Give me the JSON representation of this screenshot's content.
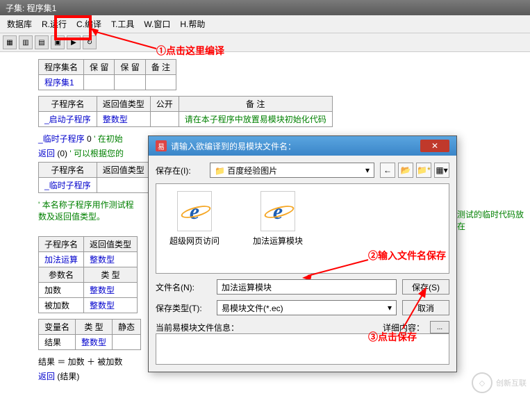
{
  "titlebar": "子集: 程序集1",
  "menu": {
    "db": "数据库",
    "run": "R.运行",
    "compile": "C.编译",
    "tools": "T.工具",
    "window": "W.窗口",
    "help": "H.帮助"
  },
  "annotations": {
    "a1": "①点击这里编译",
    "a2": "②输入文件名保存",
    "a3": "③点击保存",
    "side_note": "测试的临时代码放在"
  },
  "tables": {
    "t1": {
      "h1": "程序集名",
      "h2": "保  留",
      "h3": "保  留",
      "h4": "备  注",
      "r1c1": "程序集1"
    },
    "t2": {
      "h1": "子程序名",
      "h2": "返回值类型",
      "h3": "公开",
      "h4": "备  注",
      "r1c1": "_启动子程序",
      "r1c2": "整数型",
      "r1c4": "请在本子程序中放置易模块初始化代码"
    },
    "t3": {
      "h1": "子程序名",
      "h2": "返回值类型",
      "r1c1": "_临时子程序"
    },
    "t4": {
      "h1": "子程序名",
      "h2": "返回值类型",
      "r1c1": "加法运算",
      "r1c2": "整数型",
      "ph1": "参数名",
      "ph2": "类  型",
      "p1c1": "加数",
      "p1c2": "整数型",
      "p2c1": "被加数",
      "p2c2": "整数型"
    },
    "t5": {
      "h1": "变量名",
      "h2": "类  型",
      "h3": "静态",
      "r1c1": "结果",
      "r1c2": "整数型"
    }
  },
  "code": {
    "line1a": "_临时子程序",
    "line1b": "0",
    "line1c": "'  在初始",
    "line2a": "返回",
    "line2b": "(0)",
    "line2c": "'  可以根据您的",
    "note": "'  本名称子程序用作测试程\n数及返回值类型。",
    "line3": "结果 ＝ 加数 ＋ 被加数",
    "line4a": "返回",
    "line4b": "(结果)"
  },
  "dialog": {
    "title": "请输入欲编译到的易模块文件名：",
    "save_in_label": "保存在(I):",
    "save_in_value": "百度经验图片",
    "file1": "超级网页访问",
    "file2": "加法运算模块",
    "filename_label": "文件名(N):",
    "filename_value": "加法运算模块",
    "filetype_label": "保存类型(T):",
    "filetype_value": "易模块文件(*.ec)",
    "save_btn": "保存(S)",
    "cancel_btn": "取消",
    "info_label": "当前易模块文件信息：",
    "detail_label": "详细内容："
  },
  "watermark": "创新互联"
}
